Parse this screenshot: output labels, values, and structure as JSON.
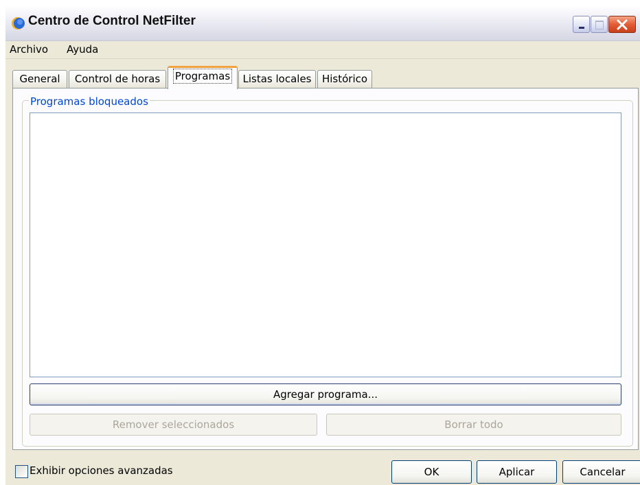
{
  "window": {
    "title": "Centro de Control NetFilter",
    "icon": "netfilter-app-icon",
    "controls": [
      "minimize-icon",
      "maximize-icon",
      "close-icon"
    ]
  },
  "menu": {
    "items": [
      "Archivo",
      "Ayuda"
    ]
  },
  "tabs": {
    "items": [
      "General",
      "Control de horas",
      "Programas",
      "Listas locales",
      "Histórico"
    ],
    "active": "Programas"
  },
  "panel": {
    "group_label": "Programas bloqueados",
    "list_items": [],
    "add_button": "Agregar programa...",
    "remove_button": "Remover seleccionados",
    "clear_button": "Borrar todo"
  },
  "footer": {
    "advanced_checkbox_label": "Exhibir opciones avanzadas",
    "advanced_checked": false,
    "ok_button": "OK",
    "apply_button": "Aplicar",
    "cancel_button": "Cancelar"
  },
  "colors": {
    "window_bg": "#ece9d8",
    "panel_bg": "#fcfcfe",
    "group_label": "#0046d5",
    "active_tab_accent": "#f2a23c",
    "close_button": "#e35d36"
  }
}
